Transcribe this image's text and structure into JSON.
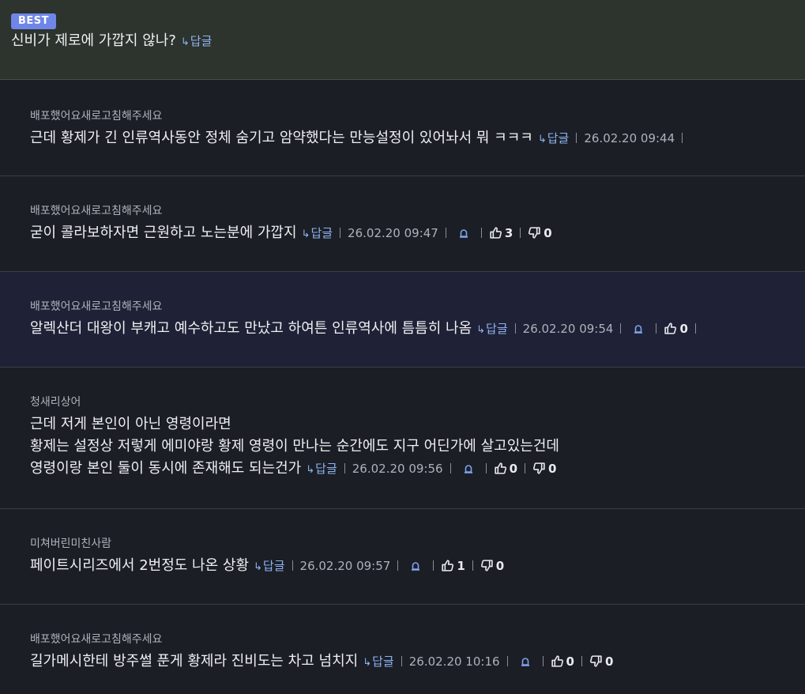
{
  "best_badge": "BEST",
  "comments": [
    {
      "author": "",
      "lines": [
        "신비가 제로에 가깝지 않나?"
      ],
      "reply": "답글"
    },
    {
      "author": "배포했어요새로고침해주세요",
      "lines": [
        "근데 황제가 긴 인류역사동안 정체 숨기고 암약했다는 만능설정이 있어놔서 뭐 ㅋㅋㅋ"
      ],
      "reply": "답글",
      "date": "26.02.20 09:44"
    },
    {
      "author": "배포했어요새로고침해주세요",
      "lines": [
        "굳이 콜라보하자면 근원하고 노는분에 가깝지"
      ],
      "reply": "답글",
      "date": "26.02.20 09:47",
      "likes": "3",
      "dislikes": "0"
    },
    {
      "author": "배포했어요새로고침해주세요",
      "lines": [
        "알렉산더 대왕이 부캐고 예수하고도 만났고 하여튼 인류역사에 틈틈히 나옴"
      ],
      "reply": "답글",
      "date": "26.02.20 09:54",
      "likes": "0"
    },
    {
      "author": "청새리상어",
      "lines": [
        "근데 저게 본인이 아닌 영령이라면",
        "황제는 설정상 저렇게 에미야랑 황제 영령이 만나는 순간에도 지구 어딘가에 살고있는건데",
        "영령이랑 본인 둘이 동시에 존재해도 되는건가"
      ],
      "reply": "답글",
      "date": "26.02.20 09:56",
      "likes": "0",
      "dislikes": "0"
    },
    {
      "author": "미쳐버린미친사람",
      "lines": [
        "페이트시리즈에서 2번정도 나온 상황"
      ],
      "reply": "답글",
      "date": "26.02.20 09:57",
      "likes": "1",
      "dislikes": "0"
    },
    {
      "author": "배포했어요새로고침해주세요",
      "lines": [
        "길가메시한테 방주썰 푼게 황제라 진비도는 차고 넘치지"
      ],
      "reply": "답글",
      "date": "26.02.20 10:16",
      "likes": "0",
      "dislikes": "0"
    }
  ]
}
